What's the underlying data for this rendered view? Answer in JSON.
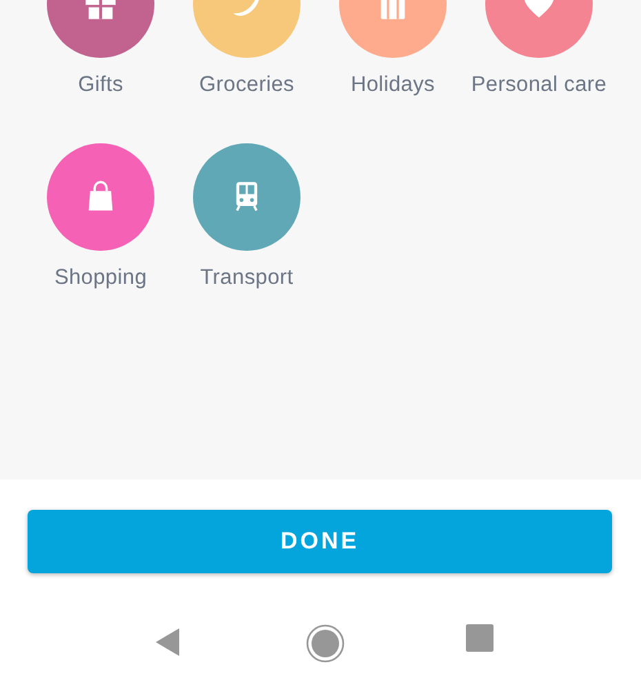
{
  "categories": [
    {
      "label": "Gifts",
      "color": "#c2628f"
    },
    {
      "label": "Groceries",
      "color": "#f7c87a"
    },
    {
      "label": "Holidays",
      "color": "#fdab8c"
    },
    {
      "label": "Personal care",
      "color": "#f58492"
    },
    {
      "label": "Shopping",
      "color": "#f562b5"
    },
    {
      "label": "Transport",
      "color": "#61a8b7"
    }
  ],
  "done_button": {
    "label": "DONE"
  }
}
